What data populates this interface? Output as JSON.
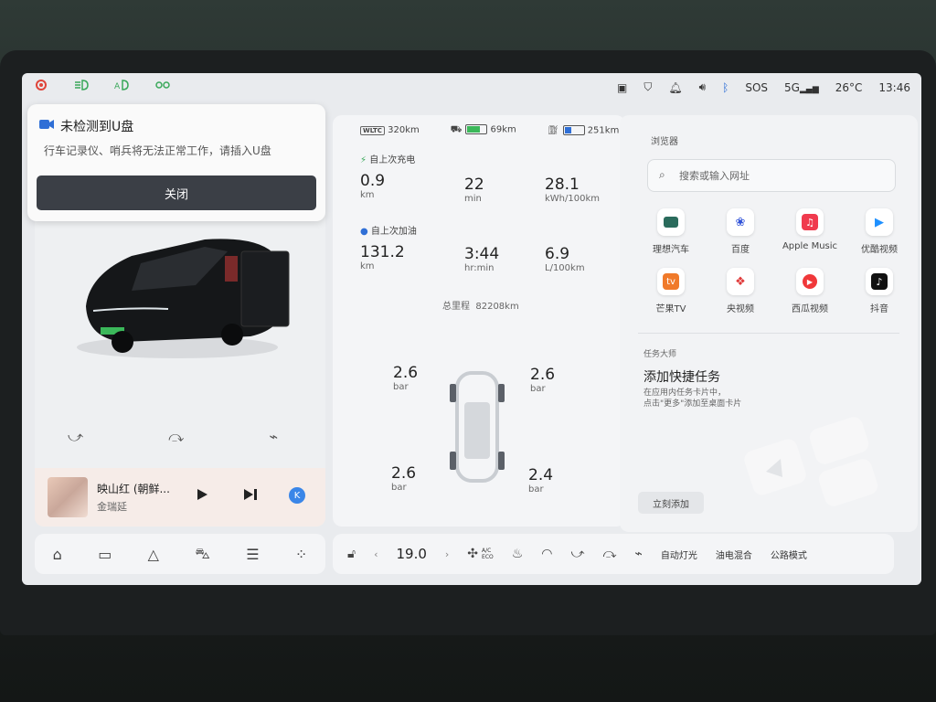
{
  "status_bar": {
    "network": "5G",
    "sos": "SOS",
    "temperature": "26°C",
    "time": "13:46"
  },
  "notification": {
    "title": "未检测到U盘",
    "message": "行车记录仪、哨兵将无法正常工作，请插入U盘",
    "close_label": "关闭"
  },
  "music": {
    "title": "映山红 (朝鲜...",
    "artist": "金瑞延",
    "k_label": "K"
  },
  "trip": {
    "wltc": "WLTC",
    "wltc_range": "320km",
    "battery_percent": "69km",
    "battery_level": 0.69,
    "fuel_range": "251km",
    "fuel_level": 0.35,
    "charge_section": "自上次充电",
    "charge_stats": [
      {
        "value": "0.9",
        "unit": "km"
      },
      {
        "value": "22",
        "unit": "min"
      },
      {
        "value": "28.1",
        "unit": "kWh/100km"
      }
    ],
    "fuel_section": "自上次加油",
    "fuel_stats": [
      {
        "value": "131.2",
        "unit": "km"
      },
      {
        "value": "3:44",
        "unit": "hr:min"
      },
      {
        "value": "6.9",
        "unit": "L/100km"
      }
    ],
    "odometer_label": "总里程",
    "odometer_value": "82208km"
  },
  "tires": {
    "fl": {
      "value": "2.6",
      "unit": "bar"
    },
    "fr": {
      "value": "2.6",
      "unit": "bar"
    },
    "rl": {
      "value": "2.6",
      "unit": "bar"
    },
    "rr": {
      "value": "2.4",
      "unit": "bar"
    }
  },
  "browser": {
    "title": "浏览器",
    "search_placeholder": "搜索或输入网址",
    "apps": [
      {
        "label": "理想汽车",
        "icon": "li-auto-icon",
        "color": "#2a6b5c"
      },
      {
        "label": "百度",
        "icon": "baidu-icon",
        "color": "#3052d8"
      },
      {
        "label": "Apple Music",
        "icon": "apple-music-icon",
        "color": "#f03a4e"
      },
      {
        "label": "优酷视频",
        "icon": "youku-icon",
        "color": "#1e90ff"
      },
      {
        "label": "芒果TV",
        "icon": "mango-tv-icon",
        "color": "#f07a2a"
      },
      {
        "label": "央视频",
        "icon": "cctv-icon",
        "color": "#e03a3a"
      },
      {
        "label": "西瓜视频",
        "icon": "xigua-icon",
        "color": "#f0383a"
      },
      {
        "label": "抖音",
        "icon": "douyin-icon",
        "color": "#111111"
      }
    ]
  },
  "tasks": {
    "title": "任务大师",
    "heading": "添加快捷任务",
    "sub1": "在应用内任务卡片中，",
    "sub2": "点击\"更多\"添加至桌面卡片",
    "button": "立刻添加"
  },
  "bottom_bar": {
    "temp": "19.0",
    "ac_label": "A/C",
    "eco_label": "ECO",
    "auto_light": "自动灯光",
    "hybrid": "油电混合",
    "road_mode": "公路模式"
  }
}
